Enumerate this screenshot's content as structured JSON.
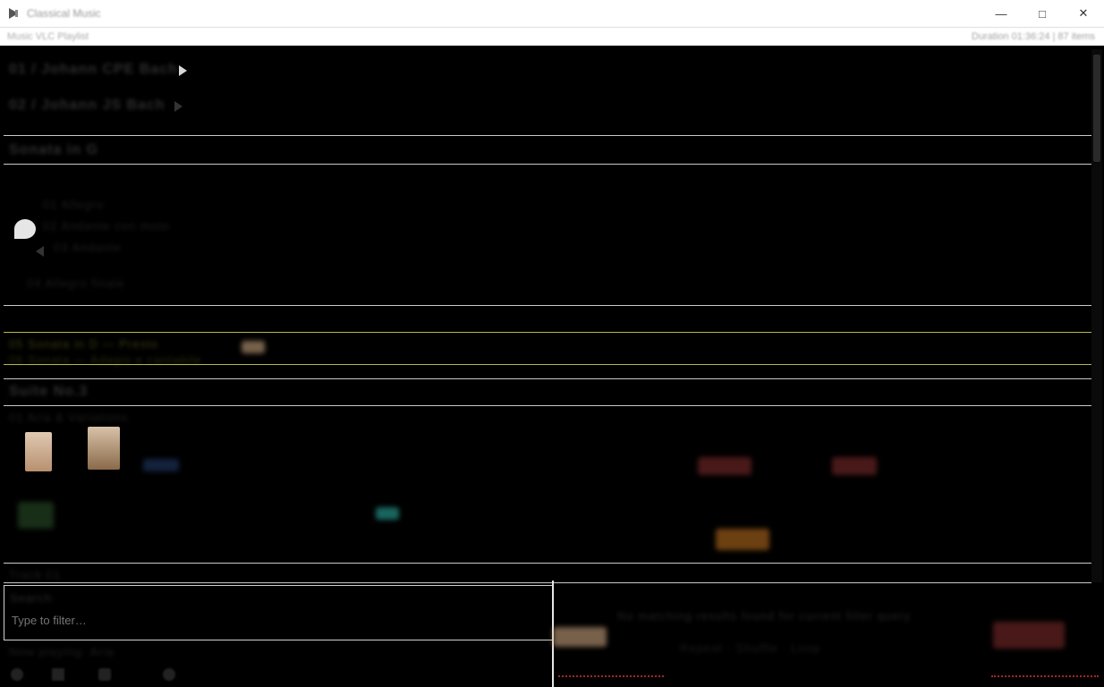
{
  "window": {
    "title": "Classical Music",
    "subtitle": "Music VLC Playlist",
    "status_right": "Duration 01:36:24 | 87 items",
    "minimize_glyph": "—",
    "maximize_glyph": "□",
    "close_glyph": "✕"
  },
  "groups": {
    "g1_a": "01 / Johann CPE Bach",
    "g1_b": "02 / Johann JS Bach",
    "g2": "Sonata in G",
    "g3_items": [
      "01  Allegro",
      "02  Andante con moto",
      "03  Andante",
      "04  Allegro finale"
    ],
    "g4_a": "05  Sonata in D — Presto",
    "g4_b": "06  Sonata — Adagio e cantabile",
    "g5": "Suite No.3",
    "g6": "01  Aria & Variations",
    "g7": "Track 01"
  },
  "search": {
    "label": "Search",
    "placeholder": "Type to filter…",
    "value": ""
  },
  "bottom": {
    "left_label": "Now playing: Aria",
    "right_a": "No matching results found for current filter query",
    "right_b": "Repeat · Shuffle · Loop"
  }
}
